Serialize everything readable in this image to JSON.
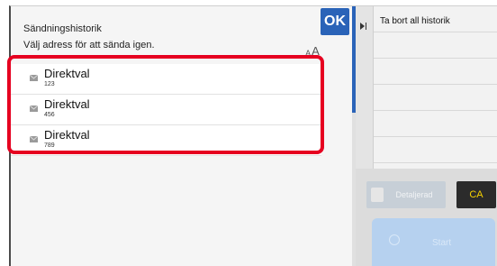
{
  "dialog": {
    "title": "Sändningshistorik",
    "subtitle": "Välj adress för att sända igen.",
    "ok_label": "OK"
  },
  "history": [
    {
      "name": "Direktval",
      "number": "123",
      "icon": "envelope-icon"
    },
    {
      "name": "Direktval",
      "number": "456",
      "icon": "envelope-icon"
    },
    {
      "name": "Direktval",
      "number": "789",
      "icon": "envelope-icon"
    }
  ],
  "side_menu": {
    "items": [
      {
        "label": "Ta bort all historik"
      },
      {
        "label": ""
      },
      {
        "label": ""
      },
      {
        "label": ""
      },
      {
        "label": ""
      },
      {
        "label": ""
      }
    ]
  },
  "buttons": {
    "ca_label": "CA",
    "start_label": "Start",
    "switch_label": "Detaljerad"
  },
  "colors": {
    "accent": "#2a63b8",
    "highlight": "#e60020",
    "ca_text": "#f6d200"
  }
}
